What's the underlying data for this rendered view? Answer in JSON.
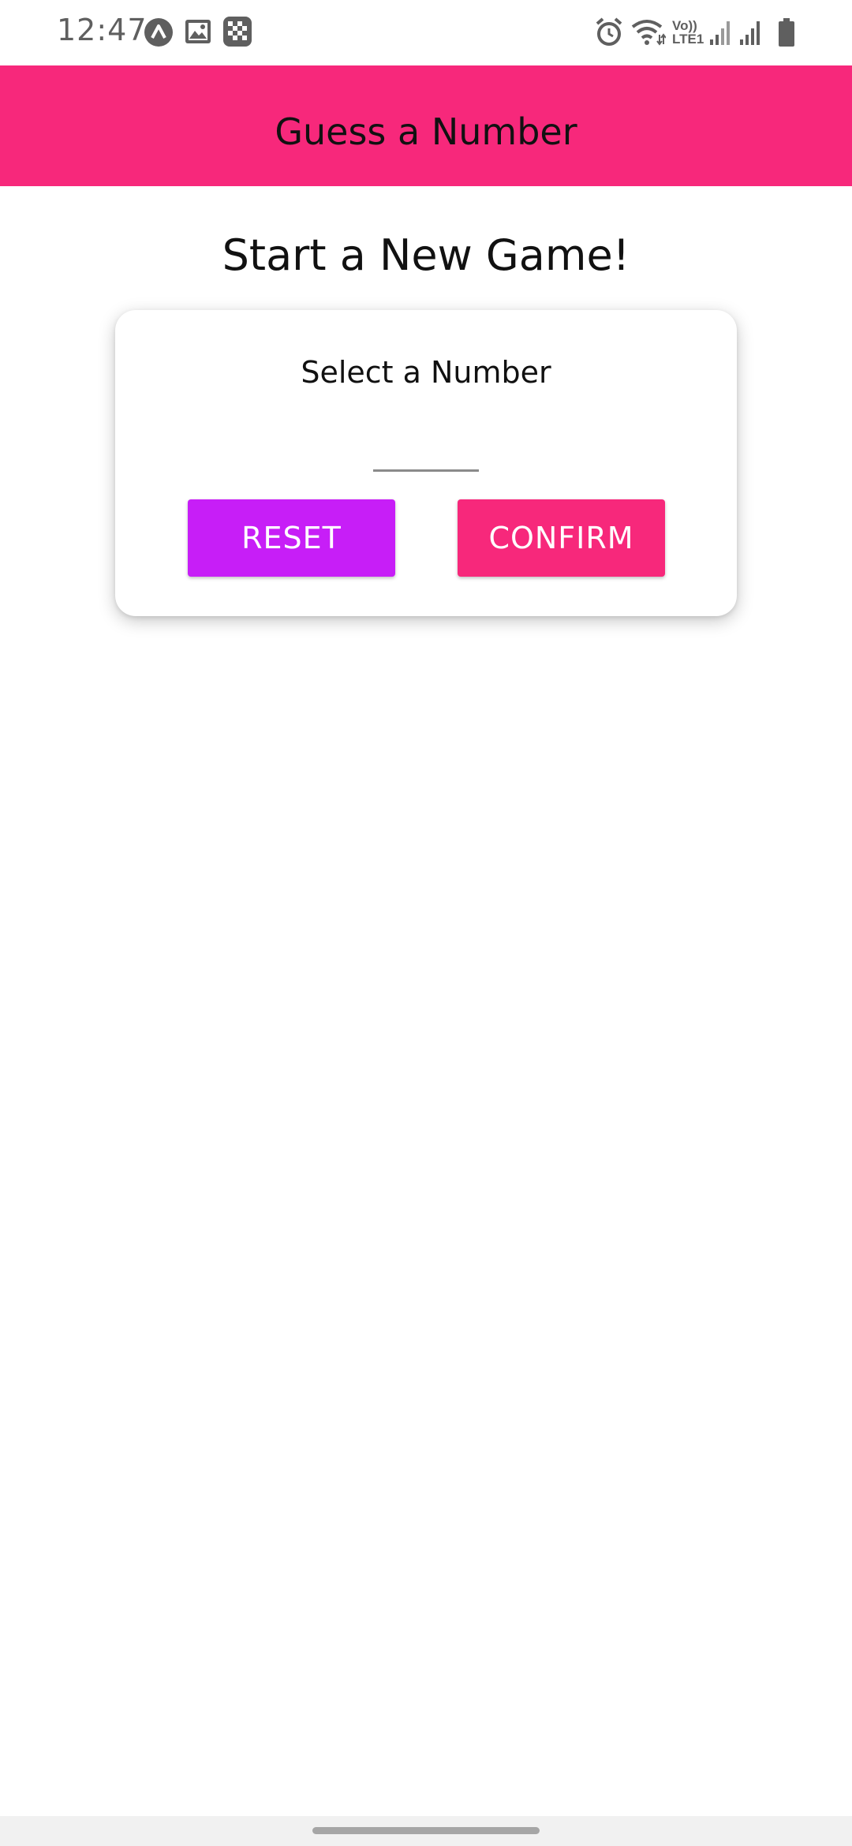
{
  "status_bar": {
    "time": "12:47",
    "lte_label_top": "Vo))",
    "lte_label_bottom": "LTE1",
    "icons": [
      "nav-arrow-icon",
      "image-icon",
      "grid-app-icon",
      "alarm-icon",
      "wifi-icon",
      "signal-icon",
      "signal-icon",
      "battery-icon"
    ]
  },
  "header": {
    "title": "Guess a Number",
    "color": "#f7287b"
  },
  "screen": {
    "title": "Start a New Game!"
  },
  "card": {
    "label": "Select a Number",
    "input_value": "",
    "reset_label": "RESET",
    "confirm_label": "CONFIRM",
    "reset_color": "#c71ef7",
    "confirm_color": "#f7287b"
  }
}
